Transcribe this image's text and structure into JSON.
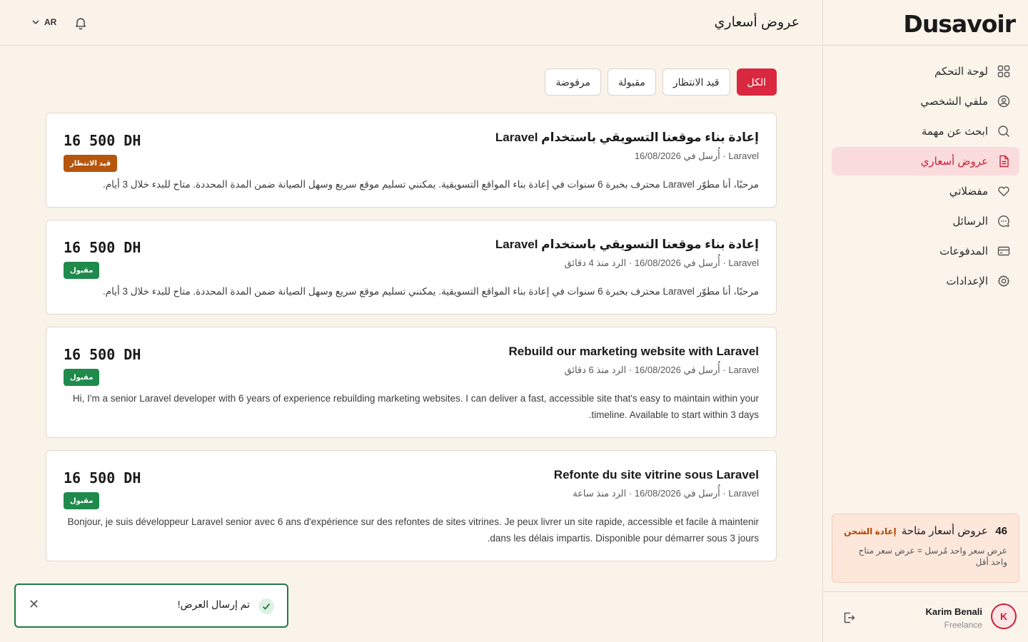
{
  "brand": {
    "logo_text": "Dusavoir",
    "accent_color": "#d9283f"
  },
  "header": {
    "page_title": "عروض أسعاري",
    "language": "AR"
  },
  "sidebar": {
    "items": [
      {
        "label": "لوحة التحكم",
        "icon": "grid-icon",
        "active": false
      },
      {
        "label": "ملفي الشخصي",
        "icon": "user-circle-icon",
        "active": false
      },
      {
        "label": "ابحث عن مهمة",
        "icon": "search-icon",
        "active": false
      },
      {
        "label": "عروض أسعاري",
        "icon": "document-icon",
        "active": true
      },
      {
        "label": "مفضلاتي",
        "icon": "heart-icon",
        "active": false
      },
      {
        "label": "الرسائل",
        "icon": "chat-icon",
        "active": false
      },
      {
        "label": "المدفوعات",
        "icon": "credit-card-icon",
        "active": false
      },
      {
        "label": "الإعدادات",
        "icon": "gear-icon",
        "active": false
      }
    ],
    "credits": {
      "count": "46",
      "label": "عروض أسعار متاحة",
      "reload": "إعادة الشحن",
      "description": "عرض سعر واحد مُرسل = عرض سعر متاح واحد أقل"
    },
    "user": {
      "initial": "K",
      "name": "Karim Benali",
      "role": "Freelance"
    }
  },
  "filters": [
    {
      "label": "الكل",
      "active": true
    },
    {
      "label": "قيد الانتظار",
      "active": false
    },
    {
      "label": "مقبولة",
      "active": false
    },
    {
      "label": "مرفوضة",
      "active": false
    }
  ],
  "quotes": [
    {
      "title": "إعادة بناء موقعنا التسويقي باستخدام Laravel",
      "meta": "Laravel · أُرسل في 16/08/2026",
      "body": "مرحبًا، أنا مطوّر Laravel محترف بخبرة 6 سنوات في إعادة بناء المواقع التسويقية. يمكنني تسليم موقع سريع وسهل الصيانة ضمن المدة المحددة. متاح للبدء خلال 3 أيام.",
      "price": "16 500 DH",
      "status": "قيد الانتظار",
      "status_type": "pending"
    },
    {
      "title": "إعادة بناء موقعنا التسويقي باستخدام Laravel",
      "meta": "Laravel · أُرسل في 16/08/2026 · الرد منذ 4 دقائق",
      "body": "مرحبًا، أنا مطوّر Laravel محترف بخبرة 6 سنوات في إعادة بناء المواقع التسويقية. يمكنني تسليم موقع سريع وسهل الصيانة ضمن المدة المحددة. متاح للبدء خلال 3 أيام.",
      "price": "16 500 DH",
      "status": "مقبول",
      "status_type": "accepted"
    },
    {
      "title": "Rebuild our marketing website with Laravel",
      "meta": "Laravel · أُرسل في 16/08/2026 · الرد منذ 6 دقائق",
      "body": "Hi, I'm a senior Laravel developer with 6 years of experience rebuilding marketing websites. I can deliver a fast, accessible site that's easy to maintain within your timeline. Available to start within 3 days.",
      "price": "16 500 DH",
      "status": "مقبول",
      "status_type": "accepted"
    },
    {
      "title": "Refonte du site vitrine sous Laravel",
      "meta": "Laravel · أُرسل في 16/08/2026 · الرد منذ ساعة",
      "body": "Bonjour, je suis développeur Laravel senior avec 6 ans d'expérience sur des refontes de sites vitrines. Je peux livrer un site rapide, accessible et facile à maintenir dans les délais impartis. Disponible pour démarrer sous 3 jours.",
      "price": "16 500 DH",
      "status": "مقبول",
      "status_type": "accepted"
    }
  ],
  "toast": {
    "message": "تم إرسال العرض!",
    "icon": "check-icon"
  }
}
